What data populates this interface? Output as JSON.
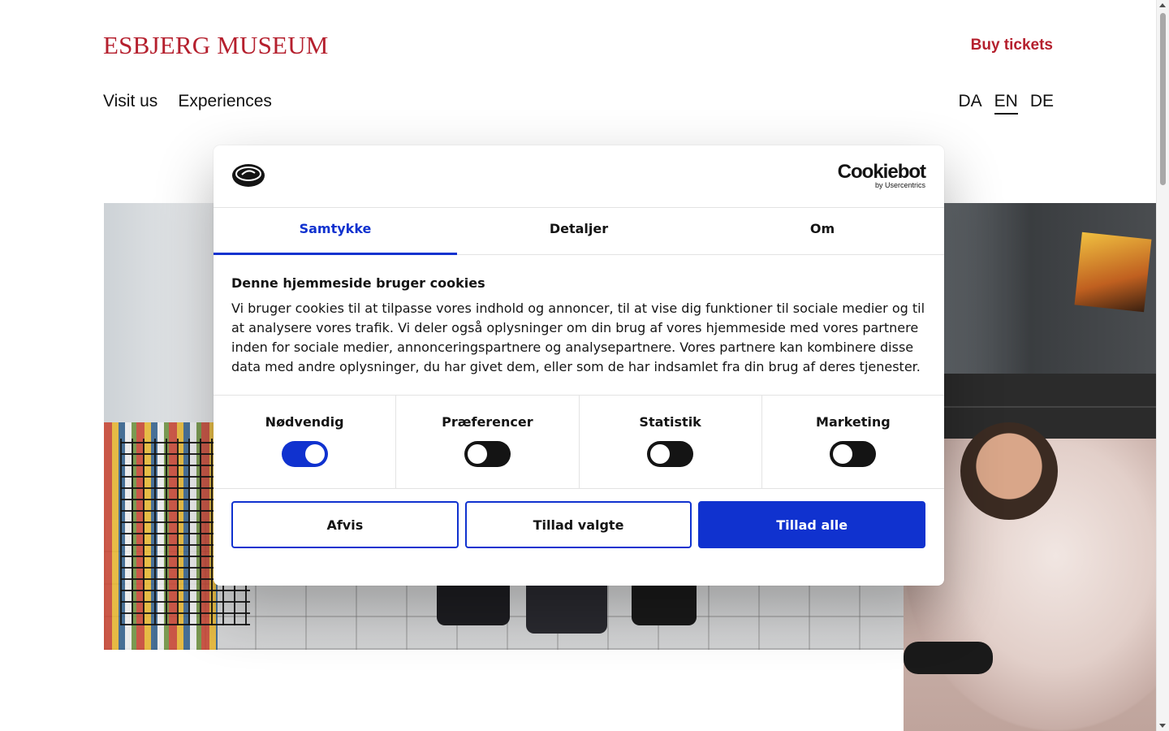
{
  "site": {
    "logo": "ESBJERG MUSEUM",
    "buy_tickets": "Buy tickets",
    "nav": [
      "Visit us",
      "Experiences"
    ],
    "languages": [
      "DA",
      "EN",
      "DE"
    ],
    "active_language": "EN"
  },
  "cookie_dialog": {
    "brand": {
      "name": "Cookiebot",
      "sub": "by Usercentrics"
    },
    "tabs": [
      "Samtykke",
      "Detaljer",
      "Om"
    ],
    "active_tab": "Samtykke",
    "heading": "Denne hjemmeside bruger cookies",
    "text": "Vi bruger cookies til at tilpasse vores indhold og annoncer, til at vise dig funktioner til sociale medier og til at analysere vores trafik. Vi deler også oplysninger om din brug af vores hjemmeside med vores partnere inden for sociale medier, annonceringspartnere og analysepartnere. Vores partnere kan kombinere disse data med andre oplysninger, du har givet dem, eller som de har indsamlet fra din brug af deres tjenester.",
    "categories": [
      {
        "label": "Nødvendig",
        "on": true
      },
      {
        "label": "Præferencer",
        "on": false
      },
      {
        "label": "Statistik",
        "on": false
      },
      {
        "label": "Marketing",
        "on": false
      }
    ],
    "buttons": {
      "deny": "Afvis",
      "allow_selected": "Tillad valgte",
      "allow_all": "Tillad alle"
    }
  },
  "colors": {
    "brand_red": "#b5202e",
    "accent_blue": "#1032cf"
  }
}
